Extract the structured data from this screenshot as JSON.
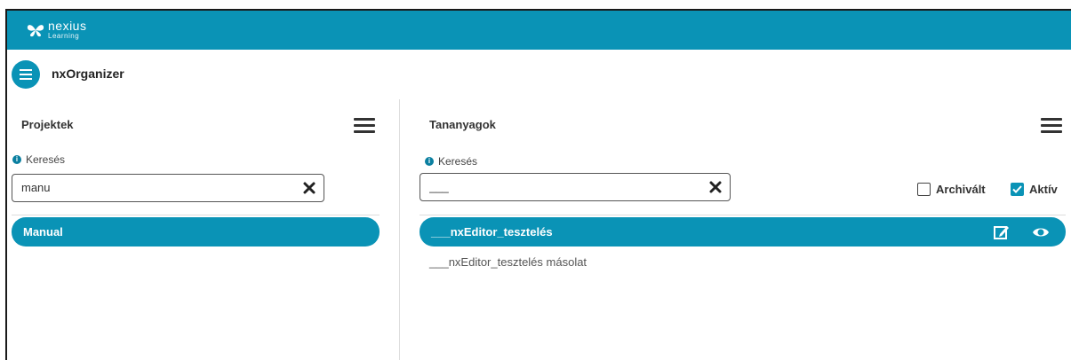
{
  "brand": {
    "name_line1": "nexius",
    "name_line2": "Learning"
  },
  "app": {
    "title": "nxOrganizer"
  },
  "projects": {
    "title": "Projektek",
    "search_label": "Keresés",
    "search_value": "manu",
    "items": [
      {
        "label": "Manual",
        "selected": true
      }
    ]
  },
  "materials": {
    "title": "Tananyagok",
    "search_label": "Keresés",
    "search_value": "___",
    "filters": [
      {
        "label": "Archivált",
        "checked": false
      },
      {
        "label": "Aktív",
        "checked": true
      }
    ],
    "items": [
      {
        "label": "___nxEditor_tesztelés",
        "selected": true
      },
      {
        "label": "___nxEditor_tesztelés másolat",
        "selected": false
      }
    ]
  },
  "colors": {
    "accent": "#0a93b6",
    "info": "#0a7fa0"
  }
}
